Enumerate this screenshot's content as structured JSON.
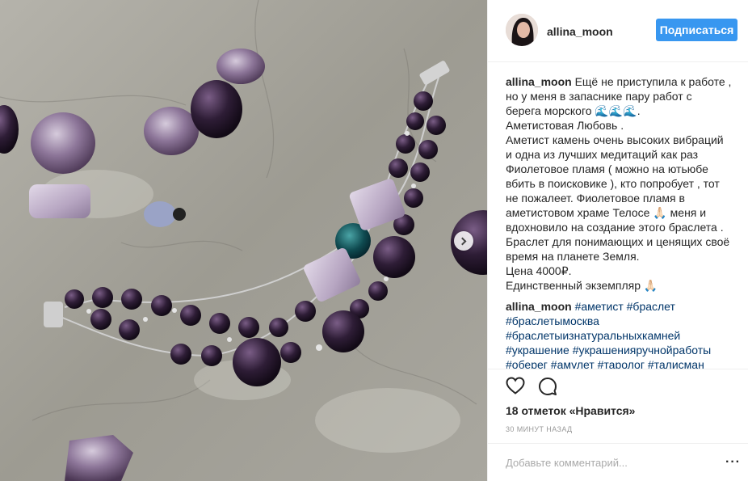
{
  "post": {
    "username": "allina_moon",
    "follow_label": "Подписаться",
    "caption_lines": [
      "Ещё не приступила к работе ,",
      "но у меня в запаснике пару работ с",
      "берега морского 🌊🌊🌊.",
      "Аметистовая Любовь .",
      "Аметист камень очень высоких вибраций",
      "и одна из лучших медитаций как раз",
      "Фиолетовое пламя ( можно на ютьюбе",
      "вбить в поисковике ), кто попробует , тот",
      "не пожалеет. Фиолетовое пламя в",
      "аметистовом храме Телосе 🙏🏻 меня и",
      "вдохновило на создание этого браслета .",
      "Браслет для понимающих и ценящих своё",
      "время на планете Земля.",
      "Цена 4000₽.",
      "Единственный экземпляр 🙏🏻"
    ],
    "hashtags_username": "allina_moon",
    "hashtags": [
      "#аметист",
      "#браслет",
      "#браслетымосква",
      "#браслетыизнатуральныхкамней",
      "#украшение",
      "#украшенияручнойработы",
      "#оберег",
      "#амулет",
      "#таролог",
      "#талисман"
    ],
    "likes_text": "18 отметок «Нравится»",
    "timestamp": "30 МИНУТ НАЗАД",
    "comment_placeholder": "Добавьте комментарий...",
    "more_label": "···"
  },
  "icons": {
    "like": "heart-icon",
    "comment": "comment-bubble-icon",
    "next": "chevron-right-icon"
  },
  "colors": {
    "follow_button": "#3897f0",
    "hashtag": "#003569",
    "divider": "#efefef"
  }
}
